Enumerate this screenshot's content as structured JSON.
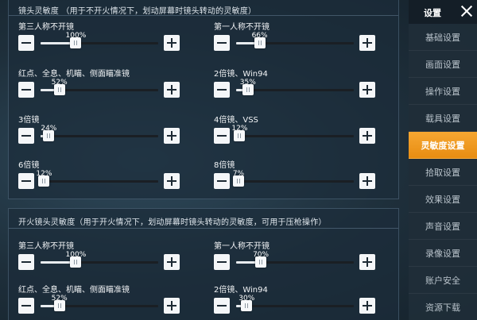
{
  "sidebar": {
    "title": "设置",
    "items": [
      {
        "label": "基础设置",
        "active": false
      },
      {
        "label": "画面设置",
        "active": false
      },
      {
        "label": "操作设置",
        "active": false
      },
      {
        "label": "载具设置",
        "active": false
      },
      {
        "label": "灵敏度设置",
        "active": true
      },
      {
        "label": "拾取设置",
        "active": false
      },
      {
        "label": "效果设置",
        "active": false
      },
      {
        "label": "声音设置",
        "active": false
      },
      {
        "label": "录像设置",
        "active": false
      },
      {
        "label": "账户安全",
        "active": false
      },
      {
        "label": "资源下载",
        "active": false
      }
    ]
  },
  "camera_section": {
    "title": "镜头灵敏度 （用于不开火情况下，划动屏幕时镜头转动的灵敏度）",
    "sliders": [
      {
        "label": "第三人称不开镜",
        "value": "100%",
        "fraction": 0.3
      },
      {
        "label": "第一人称不开镜",
        "value": "66%",
        "fraction": 0.2
      },
      {
        "label": "红点、全息、机瞄、侧面瞄准镜",
        "value": "52%",
        "fraction": 0.16
      },
      {
        "label": "2倍镜、Win94",
        "value": "35%",
        "fraction": 0.1
      },
      {
        "label": "3倍镜",
        "value": "24%",
        "fraction": 0.07
      },
      {
        "label": "4倍镜、VSS",
        "value": "12%",
        "fraction": 0.03
      },
      {
        "label": "6倍镜",
        "value": "12%",
        "fraction": 0.03
      },
      {
        "label": "8倍镜",
        "value": "7%",
        "fraction": 0.02
      }
    ]
  },
  "fire_section": {
    "title": "开火镜头灵敏度（用于开火情况下，划动屏幕时镜头转动的灵敏度，可用于压枪操作）",
    "sliders": [
      {
        "label": "第三人称不开镜",
        "value": "100%",
        "fraction": 0.3
      },
      {
        "label": "第一人称不开镜",
        "value": "70%",
        "fraction": 0.21
      },
      {
        "label": "红点、全息、机瞄、侧面瞄准镜",
        "value": "52%",
        "fraction": 0.16
      },
      {
        "label": "2倍镜、Win94",
        "value": "30%",
        "fraction": 0.09
      }
    ]
  },
  "colors": {
    "accent": "#f6a732",
    "panel_bg": "#1c2c3a",
    "track": "#1a1f24",
    "button": "#f4f6f8"
  },
  "icons": {
    "minus": "minus-icon",
    "plus": "plus-icon",
    "close": "close-icon"
  }
}
